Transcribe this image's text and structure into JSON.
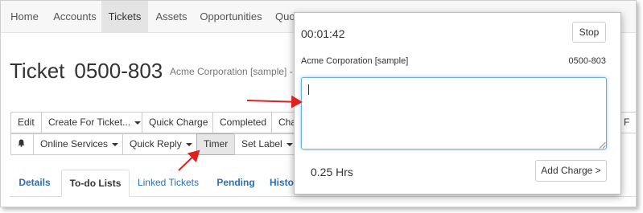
{
  "nav": {
    "items": [
      "Home",
      "Accounts",
      "Tickets",
      "Assets",
      "Opportunities",
      "Quo"
    ],
    "active": "Tickets"
  },
  "ticket": {
    "label": "Ticket",
    "number": "0500-803",
    "subtitle": "Acme Corporation [sample] -  C"
  },
  "toolbar": {
    "row1": {
      "edit": "Edit",
      "create_for_ticket": "Create For Ticket...",
      "quick_charge": "Quick Charge",
      "completed": "Completed",
      "cha": "Cha",
      "f": "F"
    },
    "row2": {
      "notifications_icon": "bell-icon",
      "online_services": "Online Services",
      "quick_reply": "Quick Reply",
      "timer": "Timer",
      "set_label": "Set Label"
    }
  },
  "tabs": {
    "details": "Details",
    "todo_lists": "To-do Lists",
    "linked_tickets": "Linked Tickets",
    "pending": "Pending",
    "history": "Histo",
    "active": "To-do Lists"
  },
  "timer_popup": {
    "elapsed": "00:01:42",
    "stop_label": "Stop",
    "company": "Acme Corporation [sample]",
    "ticket_number": "0500-803",
    "notes_value": "",
    "hours": "0.25 Hrs",
    "add_charge_label": "Add Charge >"
  },
  "colors": {
    "link": "#2a6ebb",
    "annotation_arrow": "#e02020",
    "focus_border": "#66afe9"
  }
}
